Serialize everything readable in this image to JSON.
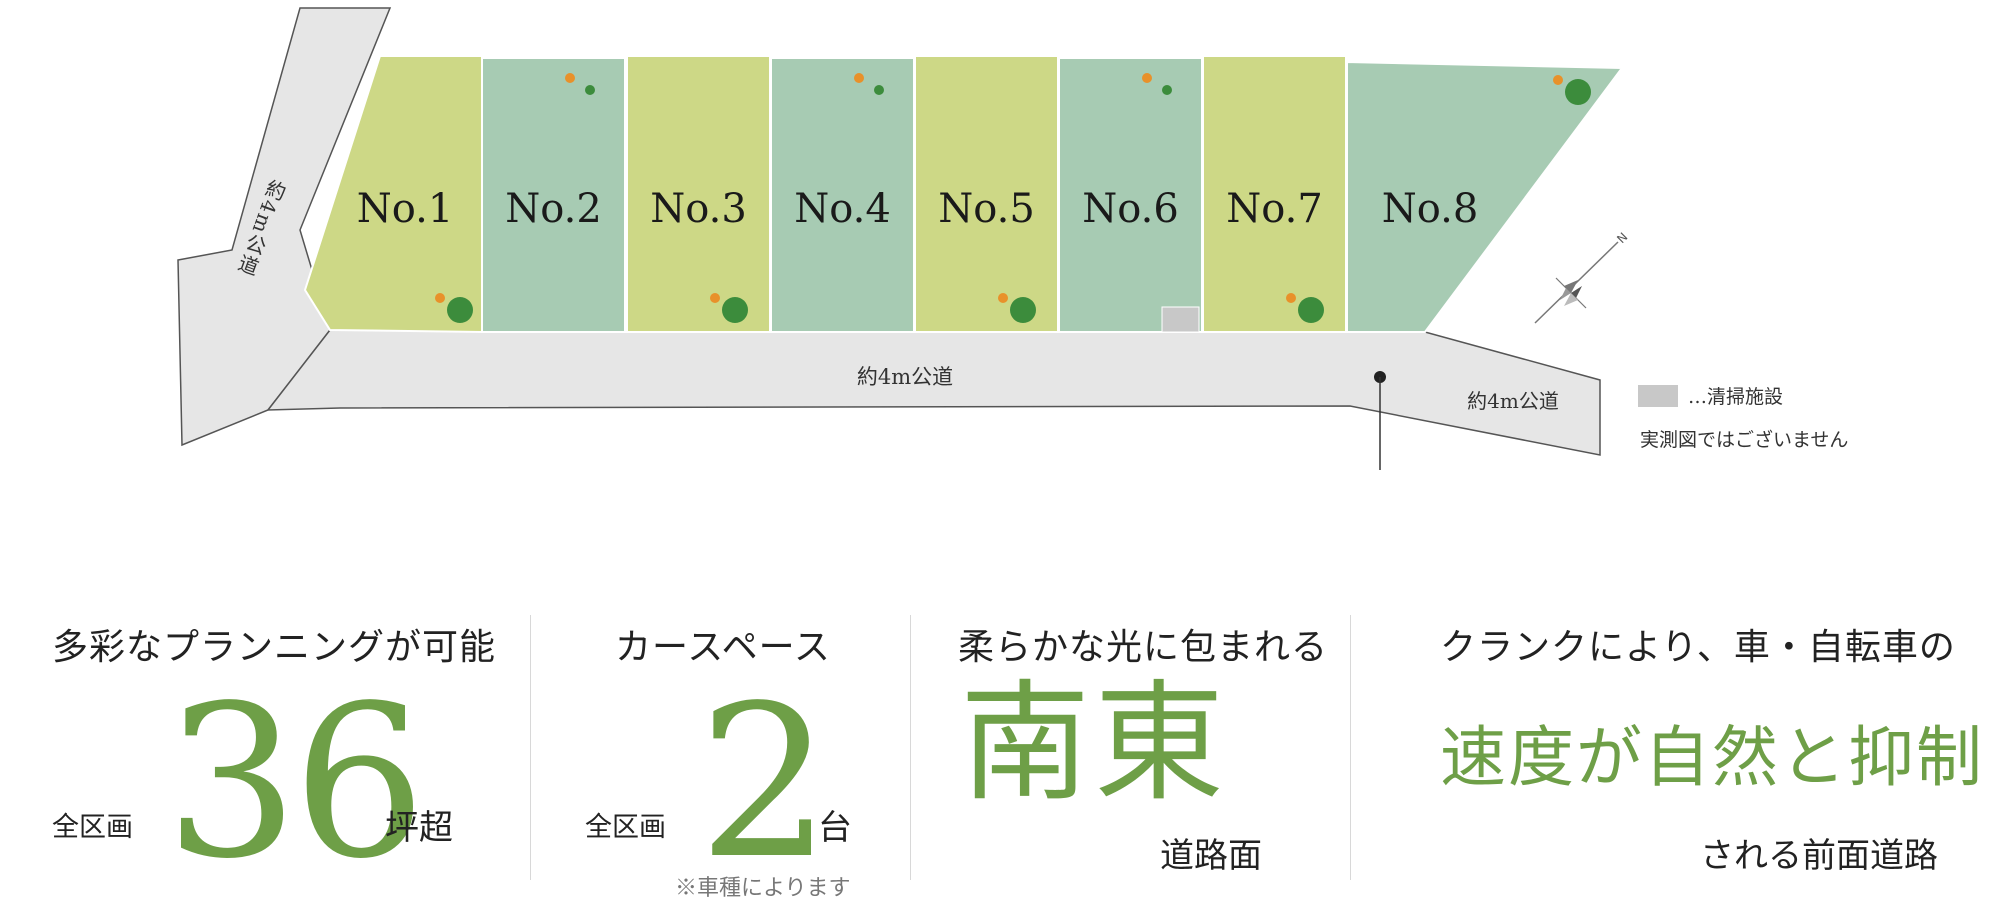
{
  "map": {
    "lots": [
      {
        "label": "No.1",
        "color": "#cdd886"
      },
      {
        "label": "No.2",
        "color": "#a7cbb3"
      },
      {
        "label": "No.3",
        "color": "#cdd886"
      },
      {
        "label": "No.4",
        "color": "#a7cbb3"
      },
      {
        "label": "No.5",
        "color": "#cdd886"
      },
      {
        "label": "No.6",
        "color": "#a7cbb3"
      },
      {
        "label": "No.7",
        "color": "#cdd886"
      },
      {
        "label": "No.8",
        "color": "#a7cbb3"
      }
    ],
    "road_left": "約4m公道",
    "road_main": "約4m公道",
    "road_right": "約4m公道",
    "compass_label": "N",
    "legend_label": "…清掃施設",
    "disclaimer": "実測図ではございません",
    "road_color": "#e6e6e6",
    "road_stroke": "#555555",
    "facility_color": "#c8c8c8"
  },
  "stats": {
    "planning": {
      "heading": "多彩なプランニングが可能",
      "prefix": "全区画",
      "value": "36",
      "suffix": "坪超"
    },
    "carspace": {
      "heading": "カースペース",
      "prefix": "全区画",
      "value": "2",
      "suffix": "台",
      "note": "※車種によります"
    },
    "light": {
      "heading": "柔らかな光に包まれる",
      "value": "南東",
      "suffix": "道路面"
    },
    "crank": {
      "heading": "クランクにより、車・自転車の",
      "value": "速度が自然と抑制",
      "suffix": "される前面道路"
    }
  },
  "accent_color": "#6e9f47"
}
